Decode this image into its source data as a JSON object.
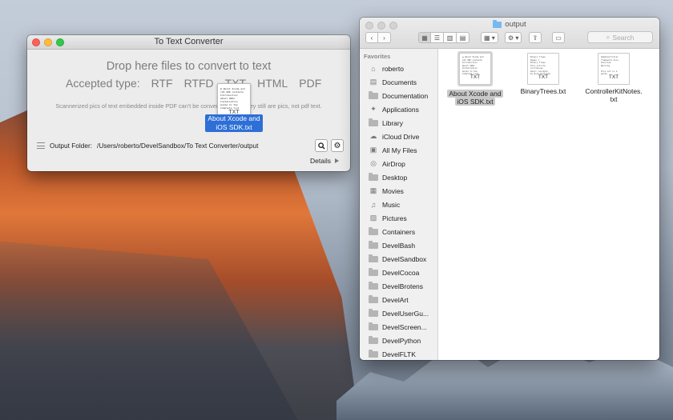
{
  "converter": {
    "title": "To Text Converter",
    "drop_title": "Drop here files to convert to text",
    "accepted_label": "Accepted type:",
    "accepted_types": [
      "RTF",
      "RTFD",
      "TXT",
      "HTML",
      "PDF"
    ],
    "note": "Scannerized pics of text embedded inside PDF can't be converted, since they still are pics, not pdf text.",
    "dragging_file_label": "About Xcode and iOS SDK.txt",
    "dragging_file_ext": "TXT",
    "output_label": "Output Folder:",
    "output_path": "/Users/roberto/DevelSandbox/To Text Converter/output",
    "details_label": "Details"
  },
  "finder": {
    "title": "output",
    "search_placeholder": "Search",
    "sidebar_header": "Favorites",
    "sidebar_items": [
      {
        "label": "roberto",
        "icon": "home-icon"
      },
      {
        "label": "Documents",
        "icon": "documents-icon"
      },
      {
        "label": "Documentation",
        "icon": "folder-icon"
      },
      {
        "label": "Applications",
        "icon": "applications-icon"
      },
      {
        "label": "Library",
        "icon": "folder-icon"
      },
      {
        "label": "iCloud Drive",
        "icon": "cloud-icon"
      },
      {
        "label": "All My Files",
        "icon": "all-files-icon"
      },
      {
        "label": "AirDrop",
        "icon": "airdrop-icon"
      },
      {
        "label": "Desktop",
        "icon": "desktop-icon"
      },
      {
        "label": "Movies",
        "icon": "movies-icon"
      },
      {
        "label": "Music",
        "icon": "music-icon"
      },
      {
        "label": "Pictures",
        "icon": "pictures-icon"
      },
      {
        "label": "Containers",
        "icon": "folder-icon"
      },
      {
        "label": "DevelBash",
        "icon": "folder-icon"
      },
      {
        "label": "DevelSandbox",
        "icon": "folder-icon"
      },
      {
        "label": "DevelCocoa",
        "icon": "folder-icon"
      },
      {
        "label": "DevelBrotens",
        "icon": "folder-icon"
      },
      {
        "label": "DevelArt",
        "icon": "folder-icon"
      },
      {
        "label": "DevelUserGu...",
        "icon": "folder-icon"
      },
      {
        "label": "DevelScreen...",
        "icon": "folder-icon"
      },
      {
        "label": "DevelPython",
        "icon": "folder-icon"
      },
      {
        "label": "DevelFLTK",
        "icon": "folder-icon"
      }
    ],
    "files": [
      {
        "name_line1": "About Xcode and",
        "name_line2": "iOS SDK.txt",
        "ext": "TXT",
        "selected": true
      },
      {
        "name_line1": "BinaryTrees.txt",
        "name_line2": "",
        "ext": "TXT",
        "selected": false
      },
      {
        "name_line1": "ControllerKitNotes.",
        "name_line2": "txt",
        "ext": "TXT",
        "selected": false
      }
    ]
  },
  "colors": {
    "selection_blue": "#2d6fd6",
    "close_red": "#fc605b",
    "minimize_yellow": "#fdbc40",
    "zoom_green": "#34c84a"
  }
}
